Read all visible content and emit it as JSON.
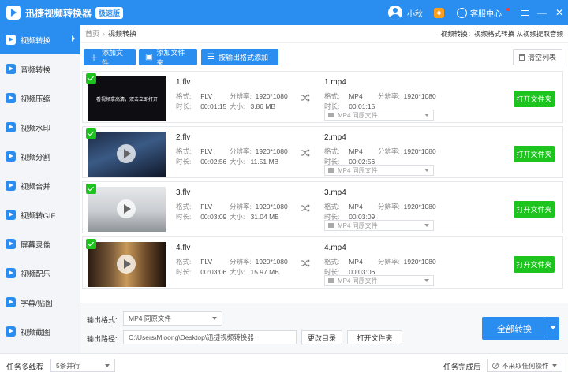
{
  "app": {
    "title": "迅捷视频转换器",
    "badge": "极速版",
    "username": "小秋",
    "service_label": "客服中心"
  },
  "sidebar": {
    "items": [
      {
        "label": "视频转换",
        "icon": "video-convert-icon",
        "active": true
      },
      {
        "label": "音频转换",
        "icon": "audio-convert-icon"
      },
      {
        "label": "视频压缩",
        "icon": "video-compress-icon"
      },
      {
        "label": "视频水印",
        "icon": "video-watermark-icon"
      },
      {
        "label": "视频分割",
        "icon": "video-split-icon"
      },
      {
        "label": "视频合并",
        "icon": "video-merge-icon"
      },
      {
        "label": "视频转GIF",
        "icon": "video-gif-icon"
      },
      {
        "label": "屏幕录像",
        "icon": "screen-record-icon"
      },
      {
        "label": "视频配乐",
        "icon": "video-music-icon"
      },
      {
        "label": "字幕/贴图",
        "icon": "subtitle-sticker-icon"
      },
      {
        "label": "视频截图",
        "icon": "video-screenshot-icon"
      }
    ]
  },
  "breadcrumb": {
    "home": "首页",
    "sep": "›",
    "current": "视频转换",
    "hint": "视频转换：视频格式转换 从视频提取音频"
  },
  "toolbar": {
    "add_file": "添加文件",
    "add_folder": "添加文件夹",
    "by_format": "按输出格式添加",
    "clear": "清空列表"
  },
  "labels": {
    "format": "格式:",
    "resolution": "分辨率:",
    "duration": "时长:",
    "size": "大小:",
    "open_folder": "打开文件夹"
  },
  "files": [
    {
      "name": "1.flv",
      "format": "FLV",
      "resolution": "1920*1080",
      "duration": "00:01:15",
      "size": "3.86 MB",
      "out_name": "1.mp4",
      "out_format": "MP4",
      "out_resolution": "1920*1080",
      "out_duration": "00:01:15",
      "out_select": "MP4  同原文件",
      "thumb_text": "看视频拿高清，双击立即打开"
    },
    {
      "name": "2.flv",
      "format": "FLV",
      "resolution": "1920*1080",
      "duration": "00:02:56",
      "size": "11.51 MB",
      "out_name": "2.mp4",
      "out_format": "MP4",
      "out_resolution": "1920*1080",
      "out_duration": "00:02:56",
      "out_select": "MP4  同原文件",
      "thumb_text": ""
    },
    {
      "name": "3.flv",
      "format": "FLV",
      "resolution": "1920*1080",
      "duration": "00:03:09",
      "size": "31.04 MB",
      "out_name": "3.mp4",
      "out_format": "MP4",
      "out_resolution": "1920*1080",
      "out_duration": "00:03:09",
      "out_select": "MP4  同原文件",
      "thumb_text": ""
    },
    {
      "name": "4.flv",
      "format": "FLV",
      "resolution": "1920*1080",
      "duration": "00:03:06",
      "size": "15.97 MB",
      "out_name": "4.mp4",
      "out_format": "MP4",
      "out_resolution": "1920*1080",
      "out_duration": "00:03:06",
      "out_select": "MP4  同原文件",
      "thumb_text": ""
    }
  ],
  "bottom": {
    "format_label": "输出格式:",
    "format_value": "MP4  同原文件",
    "path_label": "输出路径:",
    "path_value": "C:\\Users\\Mloong\\Desktop\\迅捷视频转换器",
    "change_dir": "更改目录",
    "open_folder": "打开文件夹",
    "convert_all": "全部转换"
  },
  "status": {
    "multi_label": "任务多线程",
    "multi_value": "5条并行",
    "done_label": "任务完成后",
    "done_value": "不采取任何操作"
  },
  "colors": {
    "accent": "#2a8ef0",
    "success": "#1ec41e"
  }
}
